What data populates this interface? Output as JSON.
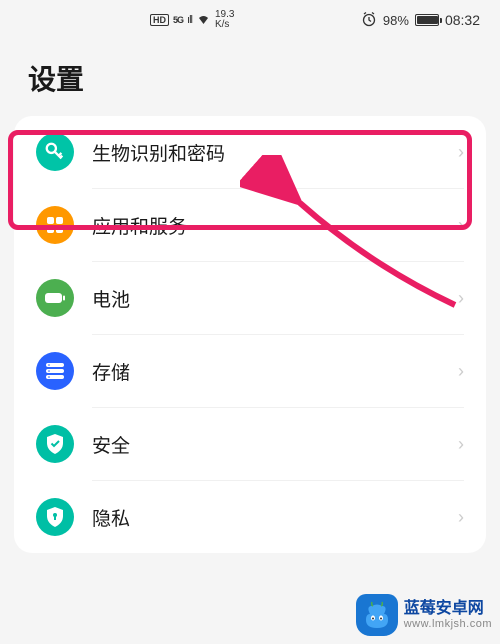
{
  "statusbar": {
    "hd": "HD",
    "network_gen": "5G",
    "net_speed_value": "19.3",
    "net_speed_unit": "K/s",
    "battery_pct": "98%",
    "time": "08:32"
  },
  "page": {
    "title": "设置"
  },
  "settings_items": [
    {
      "label": "生物识别和密码",
      "icon_color": "#00c4a7",
      "icon_name": "key-icon"
    },
    {
      "label": "应用和服务",
      "icon_color": "#ff9800",
      "icon_name": "apps-icon"
    },
    {
      "label": "电池",
      "icon_color": "#4caf50",
      "icon_name": "battery-icon"
    },
    {
      "label": "存储",
      "icon_color": "#2962ff",
      "icon_name": "storage-icon"
    },
    {
      "label": "安全",
      "icon_color": "#00bfa5",
      "icon_name": "shield-icon"
    },
    {
      "label": "隐私",
      "icon_color": "#00bfa5",
      "icon_name": "privacy-icon"
    }
  ],
  "watermark": {
    "title": "蓝莓安卓网",
    "url": "www.lmkjsh.com"
  }
}
